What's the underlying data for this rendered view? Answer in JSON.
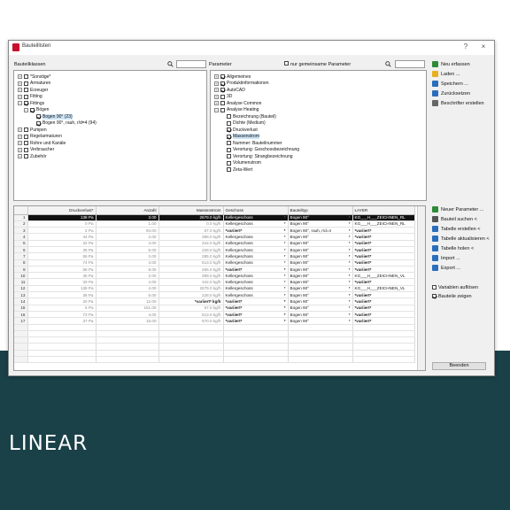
{
  "window": {
    "title": "Bauteillisten",
    "help": "?",
    "close": "×"
  },
  "left": {
    "label": "Bauteilklassen"
  },
  "right": {
    "label": "Parameter",
    "filter_label": "nur gemeinsame Parameter"
  },
  "classes": [
    {
      "label": "*Sonstige*",
      "exp": "+",
      "checked": false
    },
    {
      "label": "Armaturen",
      "exp": "+",
      "checked": false
    },
    {
      "label": "Erzeuger",
      "exp": "+",
      "checked": false
    },
    {
      "label": "Fitting",
      "exp": "+",
      "checked": false
    },
    {
      "label": "Fittings",
      "exp": "−",
      "checked": true
    },
    {
      "label": "Bögen",
      "exp": "−",
      "checked": true
    },
    {
      "label": "Bogen 90° (23)",
      "checked": true,
      "selected": true
    },
    {
      "label": "Bogen 90°, rauh, r/d=4 (94)",
      "checked": true
    },
    {
      "label": "Pumpen",
      "exp": "+",
      "checked": false
    },
    {
      "label": "Regelarmaturen",
      "exp": "+",
      "checked": false
    },
    {
      "label": "Rohre und Kanäle",
      "exp": "+",
      "checked": false
    },
    {
      "label": "Verbraucher",
      "exp": "+",
      "checked": false
    },
    {
      "label": "Zubehör",
      "exp": "+",
      "checked": false
    }
  ],
  "params": [
    {
      "label": "Allgemeines",
      "exp": "+",
      "checked": true
    },
    {
      "label": "Produktinformationen",
      "exp": "+",
      "checked": true
    },
    {
      "label": "AutoCAD",
      "exp": "+",
      "checked": true
    },
    {
      "label": "3D",
      "exp": "+",
      "checked": false
    },
    {
      "label": "Analyse Common",
      "exp": "+",
      "checked": false
    },
    {
      "label": "Analyse Heating",
      "exp": "−",
      "checked": false
    },
    {
      "label": "Bezeichnung (Bauteil)",
      "checked": false
    },
    {
      "label": "Dichte (Medium)",
      "checked": false
    },
    {
      "label": "Druckverlust",
      "checked": true
    },
    {
      "label": "Massenstrom",
      "checked": true,
      "selected": true
    },
    {
      "label": "Nummer: Bauteilnummer",
      "checked": false
    },
    {
      "label": "Verortung: Geschossbezeichnung",
      "checked": false
    },
    {
      "label": "Verortung: Strangbezeichnung",
      "checked": false
    },
    {
      "label": "Volumenstrom",
      "checked": false
    },
    {
      "label": "Zeta-Wert",
      "checked": false
    }
  ],
  "actions": [
    {
      "label": "Neu erfassen",
      "color": "#2e8b3a"
    },
    {
      "label": "Laden ...",
      "color": "#e8b020"
    },
    {
      "label": "Speichern ...",
      "color": "#2a6ebb"
    },
    {
      "label": "Zurücksetzen",
      "color": "#2a6ebb"
    },
    {
      "label": "Beschrifter erstellen",
      "color": "#666666"
    }
  ],
  "grid_actions": [
    {
      "label": "Neuer Parameter ...",
      "color": "#2e8b3a"
    },
    {
      "label": "Bauteil suchen <",
      "color": "#555555"
    },
    {
      "label": "Tabelle erstellen <",
      "color": "#2a6ebb"
    },
    {
      "label": "Tabelle aktualisieren <",
      "color": "#2a6ebb"
    },
    {
      "label": "Tabelle holen <",
      "color": "#2a6ebb"
    },
    {
      "label": "Import ...",
      "color": "#2a6ebb"
    },
    {
      "label": "Export ...",
      "color": "#2a6ebb"
    }
  ],
  "options": [
    {
      "label": "Variablen auflösen",
      "checked": false
    },
    {
      "label": "Bauteile zeigen",
      "checked": true
    }
  ],
  "close_button": "Beenden",
  "grid": {
    "columns": [
      "Druckverlust*",
      "Anzahl",
      "Massenstrom",
      "Geschoss",
      "Bauteiltyp",
      "LAYER"
    ],
    "rows": [
      [
        "1",
        "138 Pa",
        "3.00",
        "2679.0 kg/h",
        "Kellergeschoss",
        "Bogen 90°",
        "KG___H___ZEICHNEN_RL"
      ],
      [
        "2",
        "0 Pa",
        "1.00",
        "0.0 kg/h",
        "Kellergeschoss",
        "Bogen 90°",
        "KG___H___ZEICHNEN_RL"
      ],
      [
        "3",
        "2 Pa",
        "94.00",
        "57.0 kg/h",
        "*variiert*",
        "Bogen 90°, rauh, r/d=4",
        "*variiert*"
      ],
      [
        "4",
        "44 Pa",
        "2.00",
        "399.0 kg/h",
        "Kellergeschoss",
        "Bogen 90°",
        "*variiert*"
      ],
      [
        "5",
        "32 Pa",
        "4.00",
        "342.0 kg/h",
        "Kellergeschoss",
        "Bogen 90°",
        "*variiert*"
      ],
      [
        "6",
        "35 Pa",
        "5.00",
        "228.0 kg/h",
        "Kellergeschoss",
        "Bogen 90°",
        "*variiert*"
      ],
      [
        "7",
        "55 Pa",
        "2.00",
        "285.0 kg/h",
        "Kellergeschoss",
        "Bogen 90°",
        "*variiert*"
      ],
      [
        "8",
        "74 Pa",
        "4.00",
        "513.0 kg/h",
        "Kellergeschoss",
        "Bogen 90°",
        "*variiert*"
      ],
      [
        "9",
        "58 Pa",
        "8.00",
        "456.0 kg/h",
        "*variiert*",
        "Bogen 90°",
        "*variiert*"
      ],
      [
        "10",
        "45 Pa",
        "2.00",
        "399.0 kg/h",
        "Kellergeschoss",
        "Bogen 90°",
        "KG___H___ZEICHNEN_VL"
      ],
      [
        "11",
        "33 Pa",
        "4.00",
        "342.0 kg/h",
        "Kellergeschoss",
        "Bogen 90°",
        "*variiert*"
      ],
      [
        "12",
        "138 Pa",
        "4.00",
        "2679.0 kg/h",
        "Kellergeschoss",
        "Bogen 90°",
        "KG___H___ZEICHNEN_VL"
      ],
      [
        "13",
        "36 Pa",
        "5.00",
        "228.0 kg/h",
        "Kellergeschoss",
        "Bogen 90°",
        "*variiert*"
      ],
      [
        "14",
        "20 Pa",
        "12.00",
        "*variiert* kg/h",
        "*variiert*",
        "Bogen 90°",
        "*variiert*"
      ],
      [
        "15",
        "5 Pa",
        "151.00",
        "57.0 kg/h",
        "*variiert*",
        "Bogen 90°",
        "*variiert*"
      ],
      [
        "16",
        "73 Pa",
        "4.00",
        "513.0 kg/h",
        "*variiert*",
        "Bogen 90°",
        "*variiert*"
      ],
      [
        "17",
        "37 Pa",
        "15.00",
        "570.0 kg/h",
        "*variiert*",
        "Bogen 90°",
        "*variiert*"
      ]
    ]
  },
  "brand": "LINEAR"
}
